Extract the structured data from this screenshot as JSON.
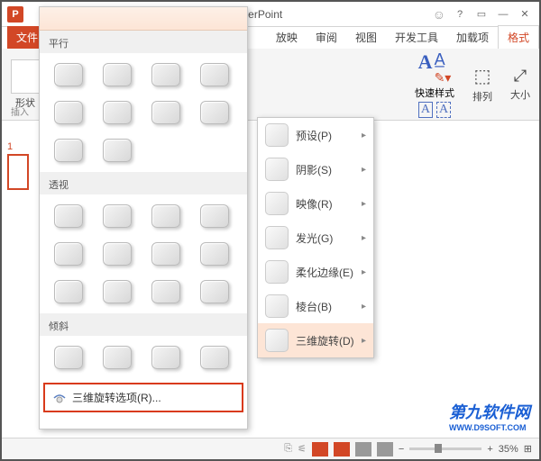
{
  "titlebar": {
    "title": "- Microsoft PowerPoint",
    "app_icon": "P"
  },
  "tabs": {
    "file": "文件",
    "animation": "放映",
    "review": "审阅",
    "view": "视图",
    "developer": "开发工具",
    "addins": "加载项",
    "format": "格式"
  },
  "ribbon": {
    "shape_label": "形状",
    "insert_label": "插入",
    "quick_styles": "快速样式",
    "arrange": "排列",
    "size": "大小"
  },
  "gallery": {
    "sections": {
      "parallel": "平行",
      "perspective": "透视",
      "oblique": "倾斜"
    },
    "footer": "三维旋转选项(R)..."
  },
  "submenu": {
    "items": [
      {
        "label": "预设(P)"
      },
      {
        "label": "阴影(S)"
      },
      {
        "label": "映像(R)"
      },
      {
        "label": "发光(G)"
      },
      {
        "label": "柔化边缘(E)"
      },
      {
        "label": "棱台(B)"
      },
      {
        "label": "三维旋转(D)"
      }
    ]
  },
  "slide": {
    "number": "1"
  },
  "statusbar": {
    "zoom": "35%"
  },
  "watermark": {
    "main": "第九软件网",
    "sub": "WWW.D9SOFT.COM"
  }
}
